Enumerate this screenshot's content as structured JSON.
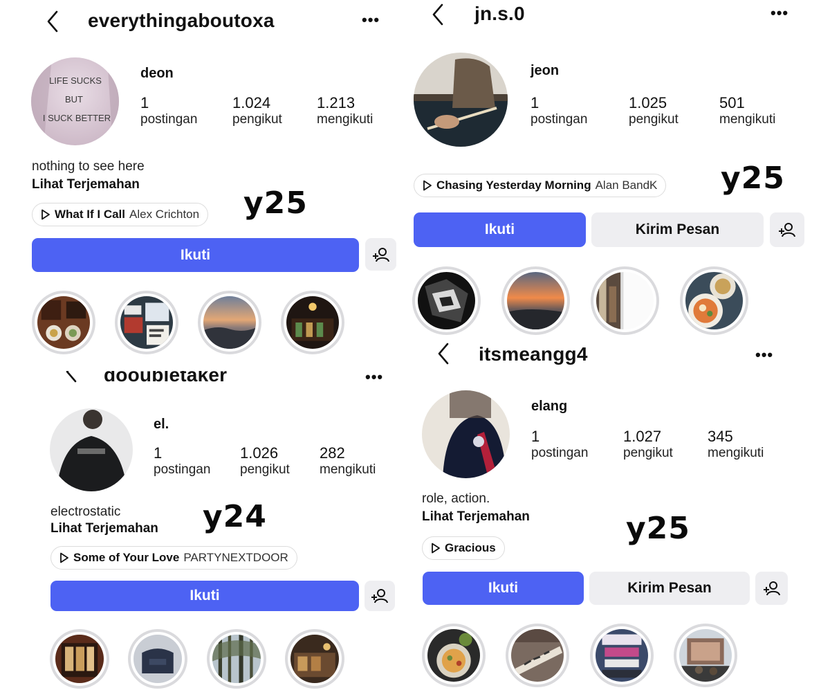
{
  "profiles": [
    {
      "username": "everythingaboutoxa",
      "name": "deon",
      "stats": [
        {
          "value": "1",
          "label": "postingan"
        },
        {
          "value": "1.024",
          "label": "pengikut"
        },
        {
          "value": "1.213",
          "label": "mengikuti"
        }
      ],
      "bio": "nothing to see here",
      "translate": "Lihat Terjemahan",
      "music": {
        "song": "What If I Call",
        "artist": "Alex Crichton"
      },
      "follow_label": "Ikuti",
      "avatar_text": [
        "LIFE SUCKS",
        "BUT",
        "I SUCK BETTER"
      ],
      "tag": "y25"
    },
    {
      "username": "jn.s.0",
      "name": "jeon",
      "stats": [
        {
          "value": "1",
          "label": "postingan"
        },
        {
          "value": "1.025",
          "label": "pengikut"
        },
        {
          "value": "501",
          "label": "mengikuti"
        }
      ],
      "music": {
        "song": "Chasing Yesterday Morning",
        "artist": "Alan BandK"
      },
      "follow_label": "Ikuti",
      "message_label": "Kirim Pesan",
      "tag": "y25"
    },
    {
      "username": "dooubletaker",
      "name": "el.",
      "stats": [
        {
          "value": "1",
          "label": "postingan"
        },
        {
          "value": "1.026",
          "label": "pengikut"
        },
        {
          "value": "282",
          "label": "mengikuti"
        }
      ],
      "bio": "electrostatic",
      "translate": "Lihat Terjemahan",
      "music": {
        "song": "Some of Your Love",
        "artist": "PARTYNEXTDOOR"
      },
      "follow_label": "Ikuti",
      "tag": "y24"
    },
    {
      "username": "itsmeangg4",
      "name": "elang",
      "stats": [
        {
          "value": "1",
          "label": "postingan"
        },
        {
          "value": "1.027",
          "label": "pengikut"
        },
        {
          "value": "345",
          "label": "mengikuti"
        }
      ],
      "bio": "role, action.",
      "translate": "Lihat Terjemahan",
      "music": {
        "song": "Gracious",
        "artist": ""
      },
      "follow_label": "Ikuti",
      "message_label": "Kirim Pesan",
      "tag": "y25"
    }
  ],
  "icons": {
    "back": "chevron-left-icon",
    "more": "more-options-icon",
    "play": "play-icon",
    "add_user": "add-user-icon"
  },
  "colors": {
    "follow": "#4d62f3",
    "secondary_button": "#eeeef1",
    "highlight_ring": "#dadadd"
  }
}
